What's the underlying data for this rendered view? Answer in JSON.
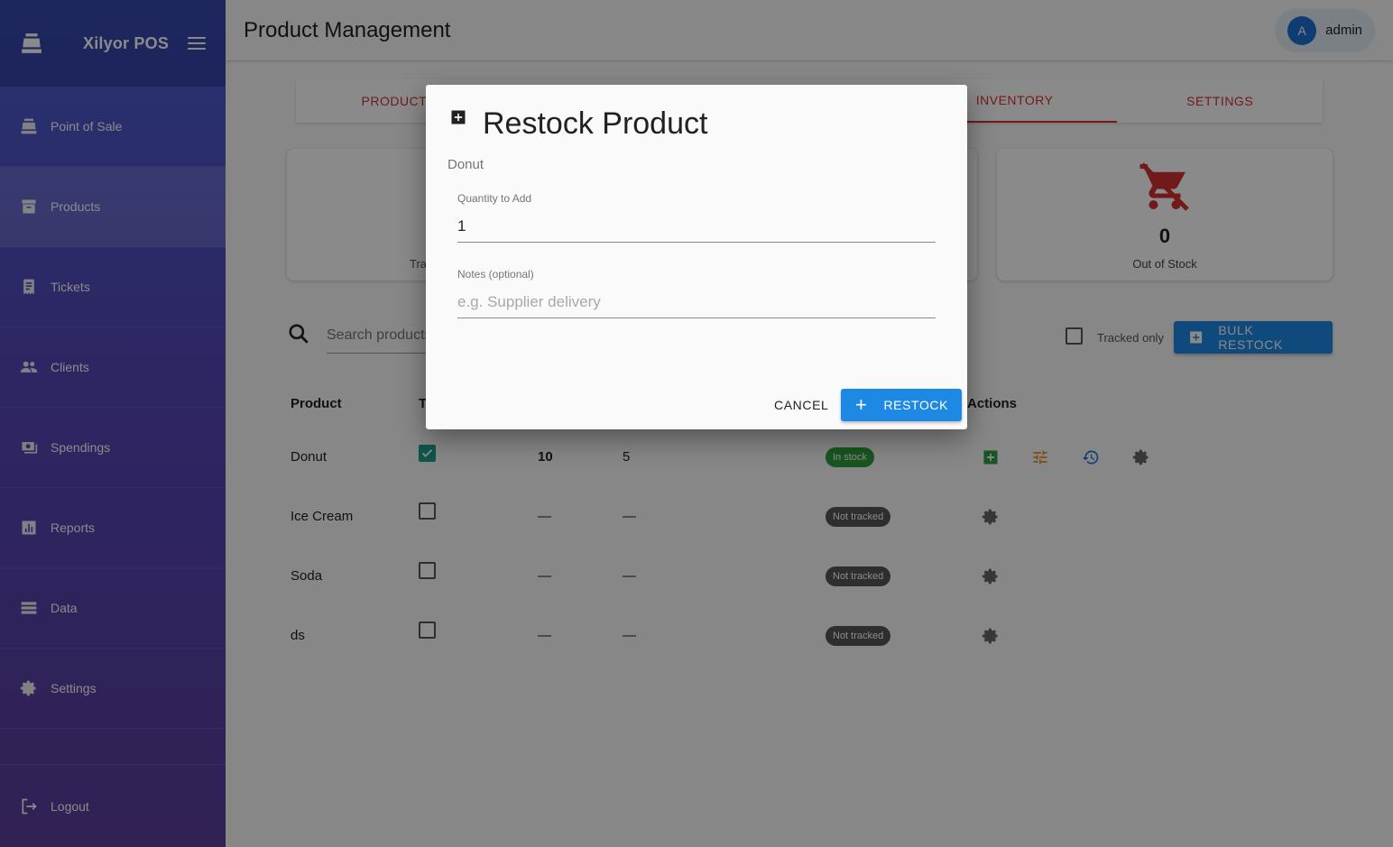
{
  "sidebar": {
    "app_title": "Xilyor POS",
    "items": [
      {
        "label": "Point of Sale",
        "icon": "cash-register-icon"
      },
      {
        "label": "Products",
        "icon": "archive-icon",
        "active": true
      },
      {
        "label": "Tickets",
        "icon": "receipt-icon"
      },
      {
        "label": "Clients",
        "icon": "people-icon"
      },
      {
        "label": "Spendings",
        "icon": "money-icon"
      },
      {
        "label": "Reports",
        "icon": "bar-chart-icon"
      },
      {
        "label": "Data",
        "icon": "storage-icon"
      },
      {
        "label": "Settings",
        "icon": "gear-icon"
      }
    ],
    "logout_label": "Logout"
  },
  "header": {
    "title": "Product Management",
    "user_initial": "A",
    "username": "admin"
  },
  "tabs": [
    {
      "label": "PRODUCTS",
      "active": false
    },
    {
      "label": "",
      "active": false
    },
    {
      "label": "",
      "active": false
    },
    {
      "label": "INVENTORY",
      "active": true
    },
    {
      "label": "SETTINGS",
      "active": false
    }
  ],
  "stats": {
    "tracked_label": "Tra",
    "out_of_stock_value": "0",
    "out_of_stock_label": "Out of Stock"
  },
  "toolbar": {
    "search_placeholder": "Search products",
    "tracked_only_label": "Tracked only",
    "bulk_restock_label": "BULK RESTOCK"
  },
  "table": {
    "headers": {
      "product": "Product",
      "tracked": "T",
      "actions": "Actions"
    },
    "rows": [
      {
        "name": "Donut",
        "tracked": true,
        "stock": "10",
        "threshold": "5",
        "status": "In stock"
      },
      {
        "name": "Ice Cream",
        "tracked": false,
        "stock": "—",
        "threshold": "—",
        "status": "Not tracked"
      },
      {
        "name": "Soda",
        "tracked": false,
        "stock": "—",
        "threshold": "—",
        "status": "Not tracked"
      },
      {
        "name": "ds",
        "tracked": false,
        "stock": "—",
        "threshold": "—",
        "status": "Not tracked"
      }
    ]
  },
  "dialog": {
    "title": "Restock Product",
    "product_name": "Donut",
    "quantity_label": "Quantity to Add",
    "quantity_value": "1",
    "notes_label": "Notes (optional)",
    "notes_placeholder": "e.g. Supplier delivery",
    "cancel_label": "CANCEL",
    "restock_label": "RESTOCK",
    "restock_icon": "+"
  },
  "colors": {
    "accent_blue": "#1e88e5",
    "tab_red": "#d32f2f",
    "in_stock_green": "#2e9e3e",
    "checkbox_teal": "#1a9e8a"
  }
}
